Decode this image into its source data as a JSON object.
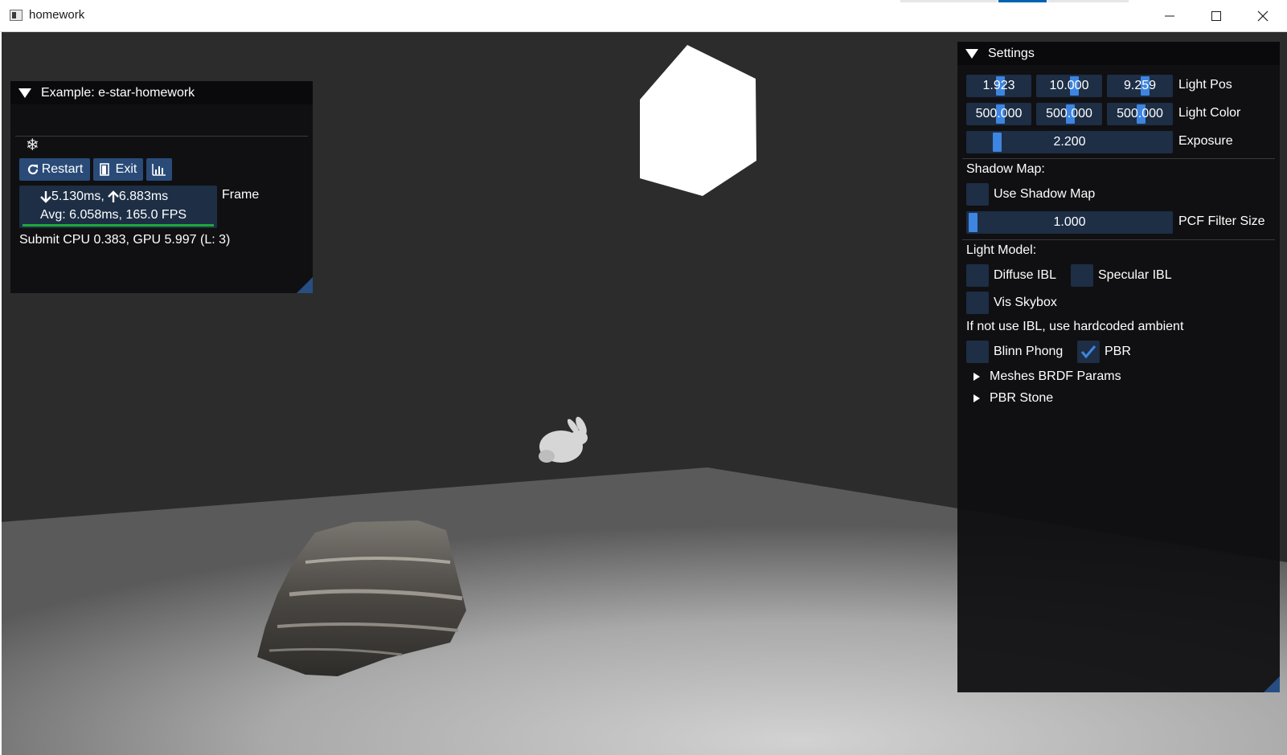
{
  "window": {
    "title": "homework"
  },
  "example_panel": {
    "title": "Example: e-star-homework",
    "snowflake_icon": "snowflake-icon",
    "restart_label": "Restart",
    "exit_label": "Exit",
    "frame_time_down": "5.130ms,",
    "frame_time_up": "6.883ms",
    "avg_line": "Avg: 6.058ms, 165.0 FPS",
    "frame_label": "Frame",
    "submit_line": "Submit CPU 0.383, GPU 5.997 (L: 3)"
  },
  "settings_panel": {
    "title": "Settings",
    "light_pos": {
      "values": [
        "1.923",
        "10.000",
        "9.259"
      ],
      "label": "Light Pos"
    },
    "light_color": {
      "values": [
        "500.000",
        "500.000",
        "500.000"
      ],
      "label": "Light Color"
    },
    "exposure": {
      "value": "2.200",
      "label": "Exposure"
    },
    "shadow_map_heading": "Shadow Map:",
    "use_shadow_map": {
      "label": "Use Shadow Map",
      "checked": false
    },
    "pcf_filter_size": {
      "value": "1.000",
      "label": "PCF Filter Size"
    },
    "light_model_heading": "Light Model:",
    "diffuse_ibl": {
      "label": "Diffuse IBL",
      "checked": false
    },
    "specular_ibl": {
      "label": "Specular IBL",
      "checked": false
    },
    "vis_skybox": {
      "label": "Vis Skybox",
      "checked": false
    },
    "ibl_note": "If not use IBL, use hardcoded ambient",
    "blinn_phong": {
      "label": "Blinn Phong",
      "checked": false
    },
    "pbr": {
      "label": "PBR",
      "checked": true
    },
    "meshes_brdf_params": "Meshes BRDF Params",
    "pbr_stone": "PBR Stone"
  },
  "colors": {
    "accent": "#3d85e0",
    "button": "#2a4b78",
    "frame_bg": "#1d2e45",
    "panel_bg": "#0f0f11",
    "fps_bar": "#1fa83a"
  }
}
